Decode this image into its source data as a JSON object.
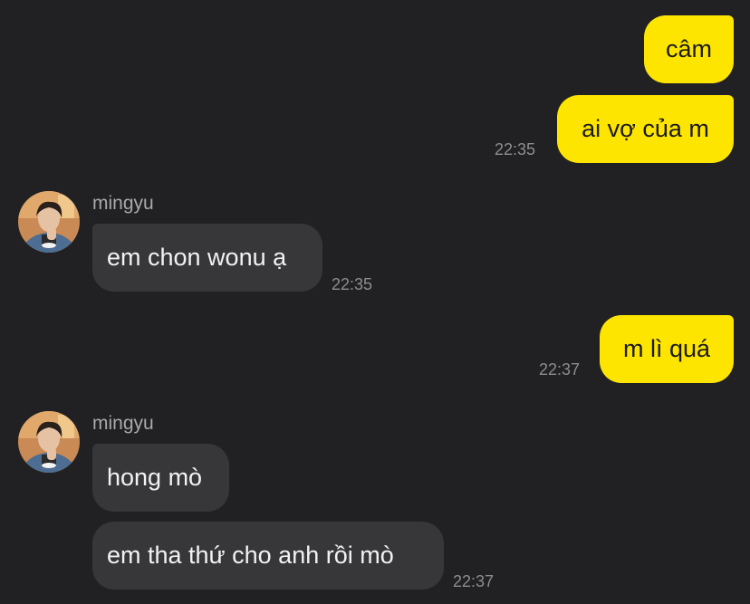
{
  "contact": {
    "name": "mingyu"
  },
  "messages": {
    "m1": {
      "text": "câm"
    },
    "m2": {
      "text": "ai vợ của m",
      "time": "22:35"
    },
    "m3": {
      "sender": "mingyu",
      "text": "em chon wonu ạ",
      "time": "22:35"
    },
    "m4": {
      "text": "m lì quá",
      "time": "22:37"
    },
    "m5": {
      "sender": "mingyu",
      "text": "hong mò"
    },
    "m6": {
      "text": "em tha thứ cho anh rồi mò",
      "time": "22:37"
    }
  },
  "colors": {
    "background": "#212123",
    "outgoing_bubble": "#fee500",
    "incoming_bubble": "#37373a",
    "timestamp": "#8d8d8f"
  },
  "icons": {
    "avatar": "profile-photo-avatar"
  }
}
